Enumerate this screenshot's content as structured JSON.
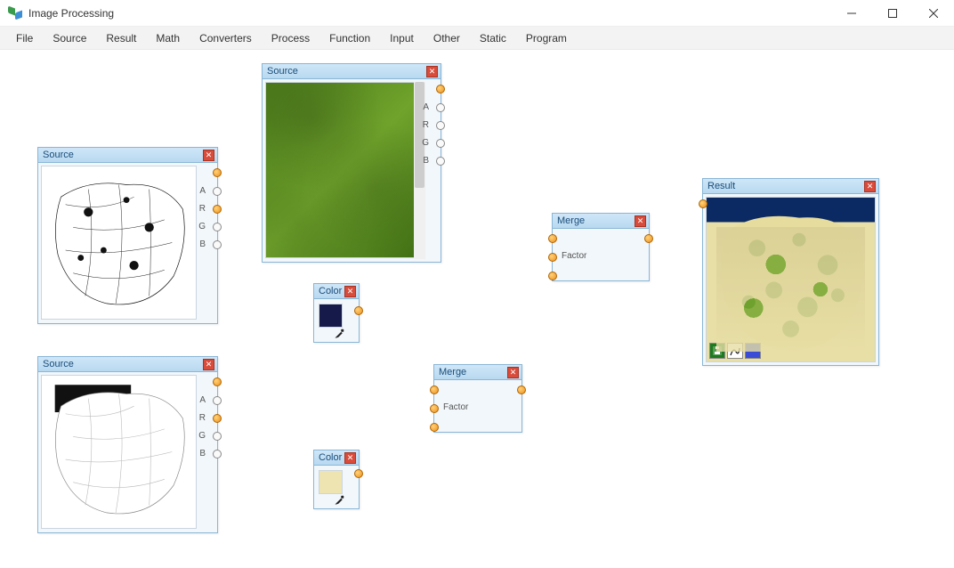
{
  "window": {
    "title": "Image Processing"
  },
  "menu": [
    "File",
    "Source",
    "Result",
    "Math",
    "Converters",
    "Process",
    "Function",
    "Input",
    "Other",
    "Static",
    "Program"
  ],
  "nodes": {
    "source1": {
      "title": "Source",
      "ports": [
        "A",
        "R",
        "G",
        "B"
      ]
    },
    "source2": {
      "title": "Source",
      "ports": [
        "A",
        "R",
        "G",
        "B"
      ]
    },
    "source3": {
      "title": "Source",
      "ports": [
        "A",
        "R",
        "G",
        "B"
      ]
    },
    "color1": {
      "title": "Color"
    },
    "color2": {
      "title": "Color"
    },
    "merge1": {
      "title": "Merge",
      "factor": "Factor"
    },
    "merge2": {
      "title": "Merge",
      "factor": "Factor"
    },
    "result": {
      "title": "Result"
    }
  }
}
